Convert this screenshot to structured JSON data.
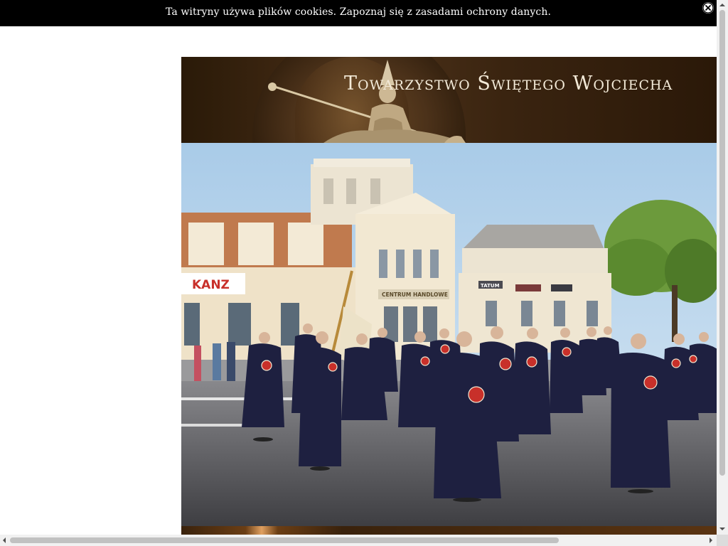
{
  "cookie_bar": {
    "message": "Ta witryny używa plików cookies. Zapoznaj się z zasadami ochrony danych.",
    "close_icon": "close-circle-icon"
  },
  "header": {
    "title": "Towarzystwo Świętego Wojciecha"
  },
  "hero": {
    "signs": {
      "kanz": "KANZ",
      "centrum": "CENTRUM HANDLOWE",
      "tatum": "TATUM"
    }
  },
  "colors": {
    "cookie_bg": "#000000",
    "header_bg": "#3b2510",
    "title_color": "#f3ead8",
    "robe": "#1a1c3a",
    "badge": "#c8302a",
    "sky": "#b9d6ec",
    "road": "#4a4a4e"
  }
}
